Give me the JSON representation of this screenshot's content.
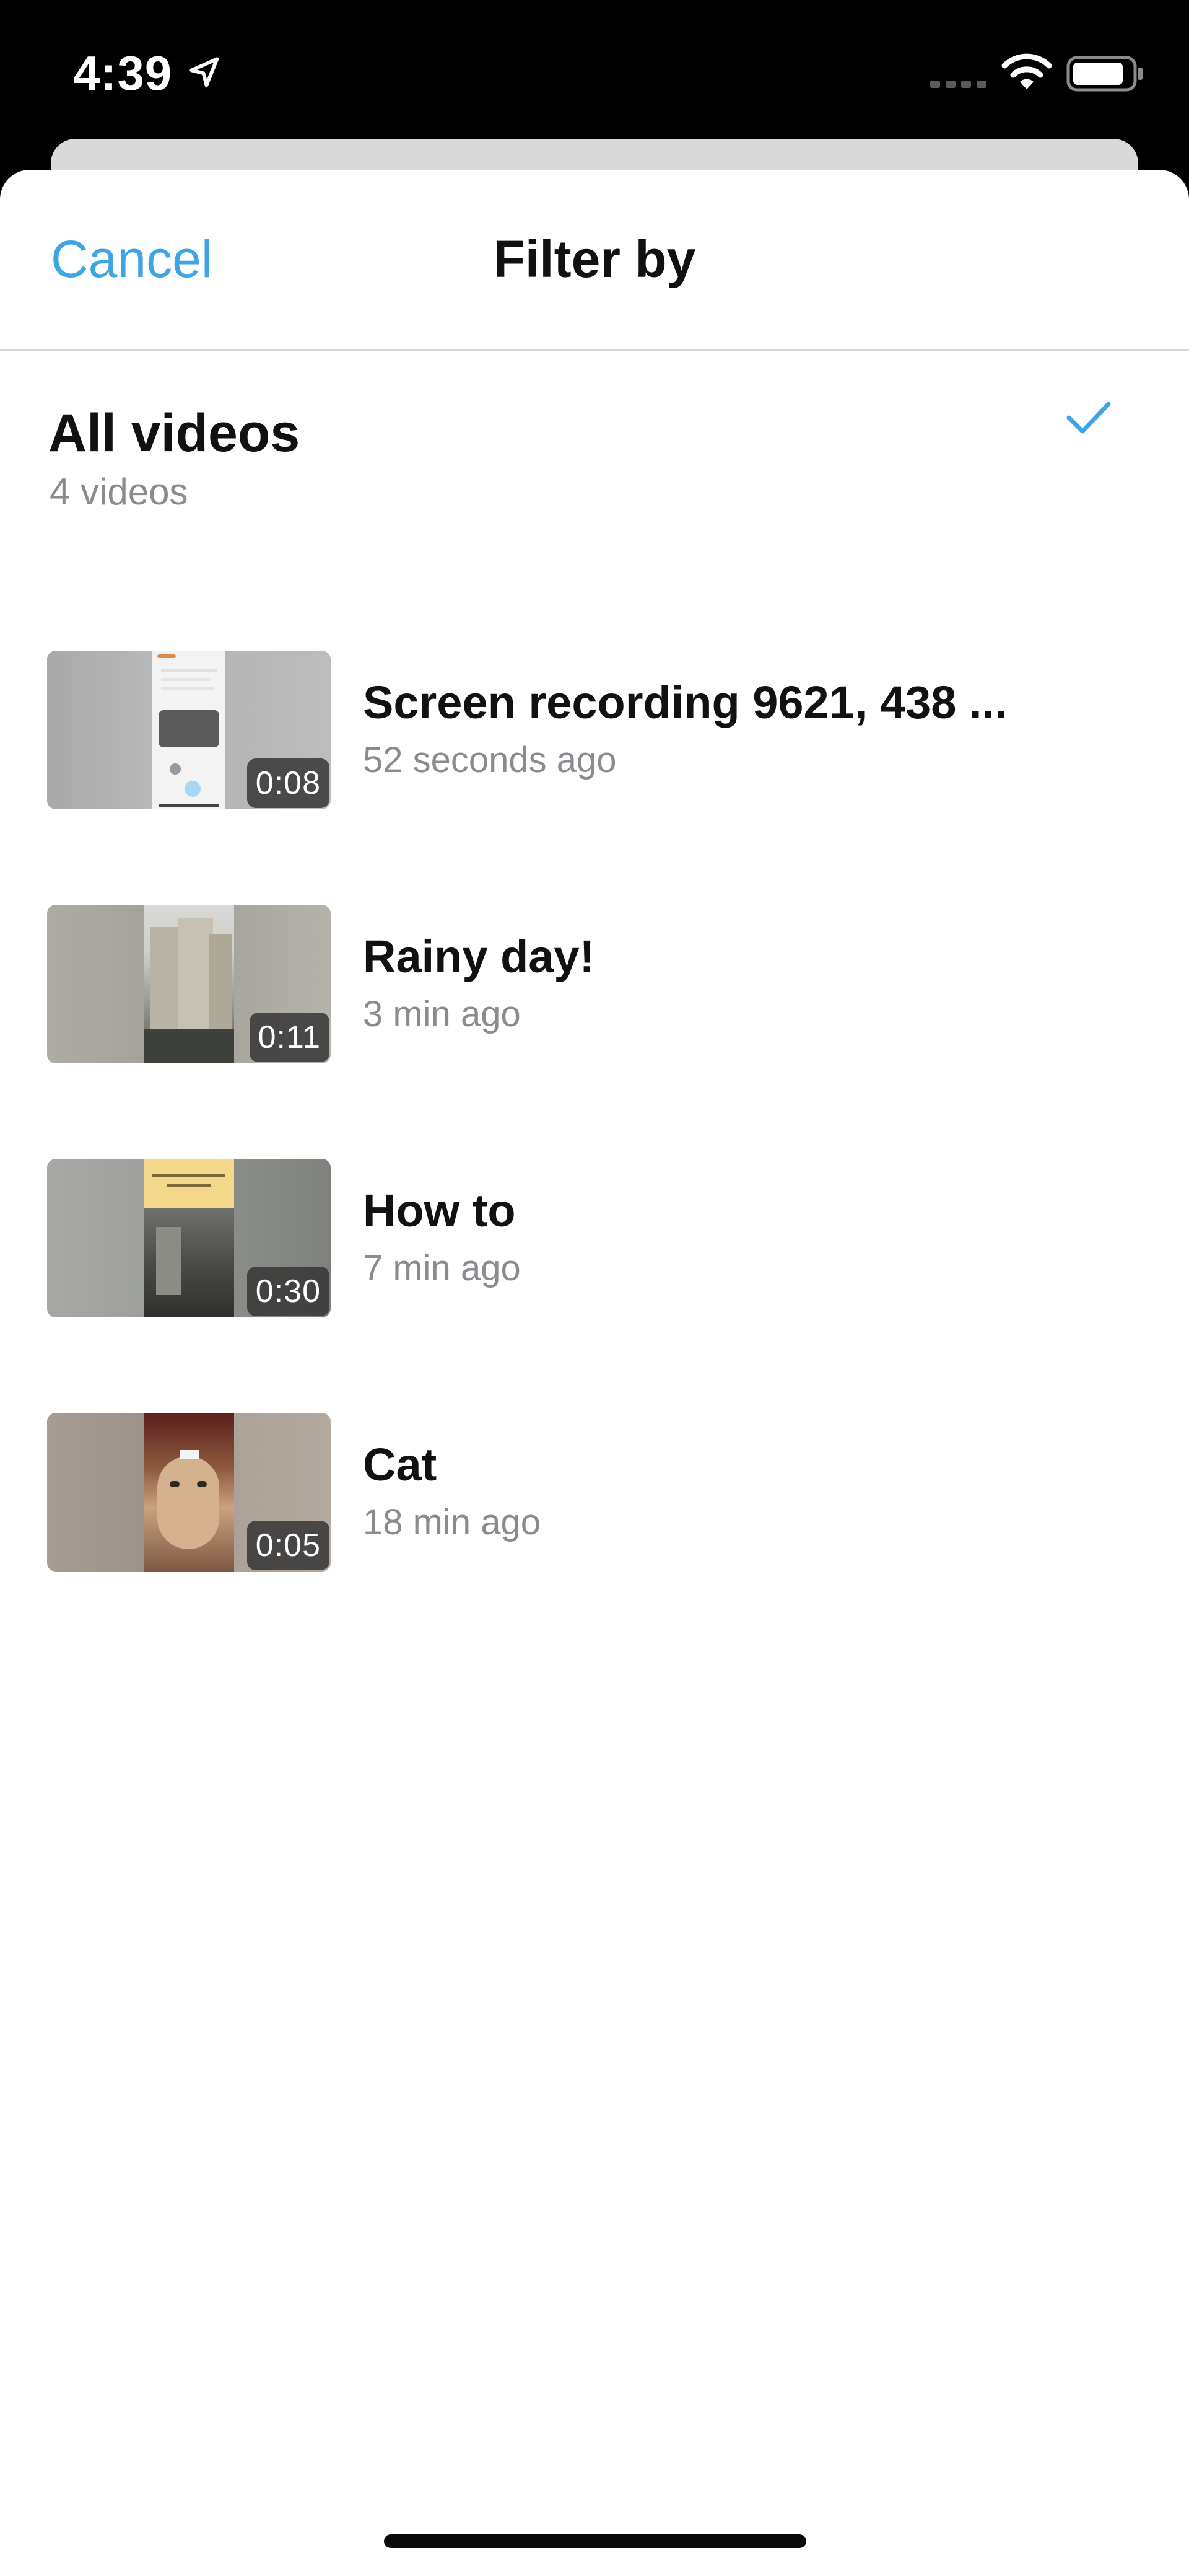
{
  "status_bar": {
    "time": "4:39",
    "icons": [
      "location-arrow-icon",
      "cellular-signal-icon",
      "wifi-icon",
      "battery-icon"
    ]
  },
  "nav": {
    "cancel_label": "Cancel",
    "title": "Filter by"
  },
  "all_videos": {
    "title": "All videos",
    "count": "4 videos",
    "selected": true
  },
  "videos": [
    {
      "title": "Screen recording 9621, 438 ...",
      "time_ago": "52 seconds ago",
      "duration": "0:08",
      "thumbnail": "screen-recording"
    },
    {
      "title": "Rainy day!",
      "time_ago": "3 min ago",
      "duration": "0:11",
      "thumbnail": "buildings"
    },
    {
      "title": "How to",
      "time_ago": "7 min ago",
      "duration": "0:30",
      "thumbnail": "how-to-street"
    },
    {
      "title": "Cat",
      "time_ago": "18 min ago",
      "duration": "0:05",
      "thumbnail": "cat"
    }
  ],
  "colors": {
    "accent": "#3fa4e3",
    "secondary_text": "#8a8a8f",
    "primary_text": "#111111"
  }
}
